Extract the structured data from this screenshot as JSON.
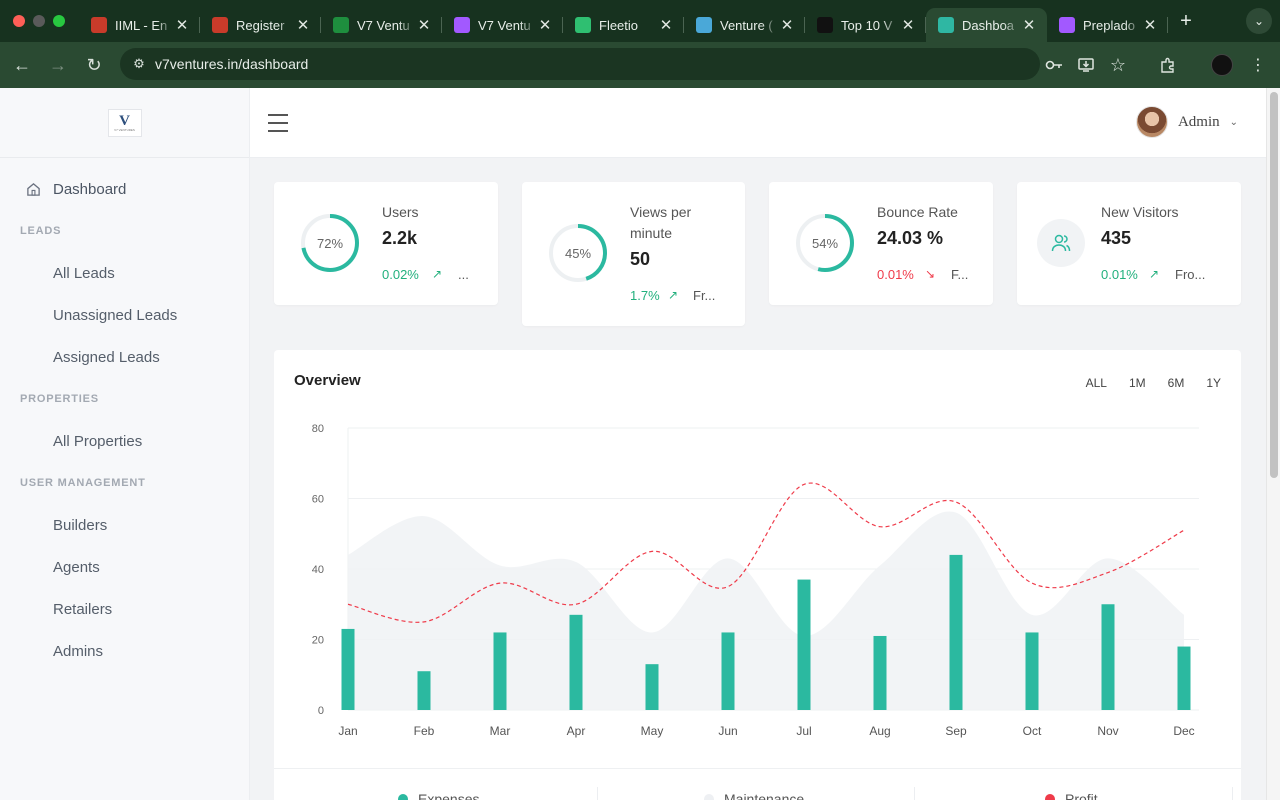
{
  "browser": {
    "tabs": [
      {
        "label": "IIML - En",
        "fav_color": "#c83b2a",
        "active": false
      },
      {
        "label": "Register",
        "fav_color": "#c83b2a",
        "active": false
      },
      {
        "label": "V7 Ventu",
        "fav_color": "#1e8e3e",
        "active": false
      },
      {
        "label": "V7 Ventu",
        "fav_color": "#a259ff",
        "active": false
      },
      {
        "label": "Fleetio",
        "fav_color": "#2fbf71",
        "active": false
      },
      {
        "label": "Venture (",
        "fav_color": "#4aa8d8",
        "active": false
      },
      {
        "label": "Top 10 V",
        "fav_color": "#111111",
        "active": false
      },
      {
        "label": "Dashboa",
        "fav_color": "#2fb7a3",
        "active": true
      },
      {
        "label": "Preplado",
        "fav_color": "#a259ff",
        "active": false
      }
    ],
    "url": "v7ventures.in/dashboard"
  },
  "sidebar": {
    "dashboard_label": "Dashboard",
    "sections": [
      {
        "heading": "LEADS",
        "items": [
          "All Leads",
          "Unassigned Leads",
          "Assigned Leads"
        ]
      },
      {
        "heading": "PROPERTIES",
        "items": [
          "All Properties"
        ]
      },
      {
        "heading": "USER MANAGEMENT",
        "items": [
          "Builders",
          "Agents",
          "Retailers",
          "Admins"
        ]
      }
    ]
  },
  "header": {
    "user_name": "Admin"
  },
  "stats": [
    {
      "ring_label": "72%",
      "ring_value": 72,
      "title": "Users",
      "value": "2.2k",
      "change": "0.02%",
      "direction": "up",
      "from": "..."
    },
    {
      "ring_label": "45%",
      "ring_value": 45,
      "title": "Views per minute",
      "value": "50",
      "change": "1.7%",
      "direction": "up",
      "from": "Fr..."
    },
    {
      "ring_label": "54%",
      "ring_value": 54,
      "title": "Bounce Rate",
      "value": "24.03 %",
      "change": "0.01%",
      "direction": "down",
      "from": "F..."
    },
    {
      "ring_label": "",
      "title": "New Visitors",
      "value": "435",
      "change": "0.01%",
      "direction": "up",
      "from": "Fro..."
    }
  ],
  "overview": {
    "title": "Overview",
    "filters": [
      "ALL",
      "1M",
      "6M",
      "1Y"
    ],
    "legend": [
      {
        "label": "Expenses",
        "color": "#2bb9a0"
      },
      {
        "label": "Maintenance",
        "color": "#eef0f3"
      },
      {
        "label": "Profit",
        "color": "#ef3b4a"
      }
    ]
  },
  "chart_data": {
    "type": "bar",
    "categories": [
      "Jan",
      "Feb",
      "Mar",
      "Apr",
      "May",
      "Jun",
      "Jul",
      "Aug",
      "Sep",
      "Oct",
      "Nov",
      "Dec"
    ],
    "ylim": [
      0,
      80
    ],
    "yticks": [
      0,
      20,
      40,
      60,
      80
    ],
    "series": [
      {
        "name": "Expenses",
        "type": "bar",
        "color": "#2bb9a0",
        "values": [
          23,
          11,
          22,
          27,
          13,
          22,
          37,
          21,
          44,
          22,
          30,
          18
        ]
      },
      {
        "name": "Maintenance",
        "type": "area",
        "color": "#eef0f3",
        "values": [
          44,
          55,
          41,
          42,
          22,
          43,
          21,
          41,
          56,
          27,
          43,
          27
        ]
      },
      {
        "name": "Profit",
        "type": "line",
        "color": "#ef3b4a",
        "dashed": true,
        "values": [
          30,
          25,
          36,
          30,
          45,
          35,
          64,
          52,
          59,
          36,
          39,
          51
        ]
      }
    ]
  }
}
